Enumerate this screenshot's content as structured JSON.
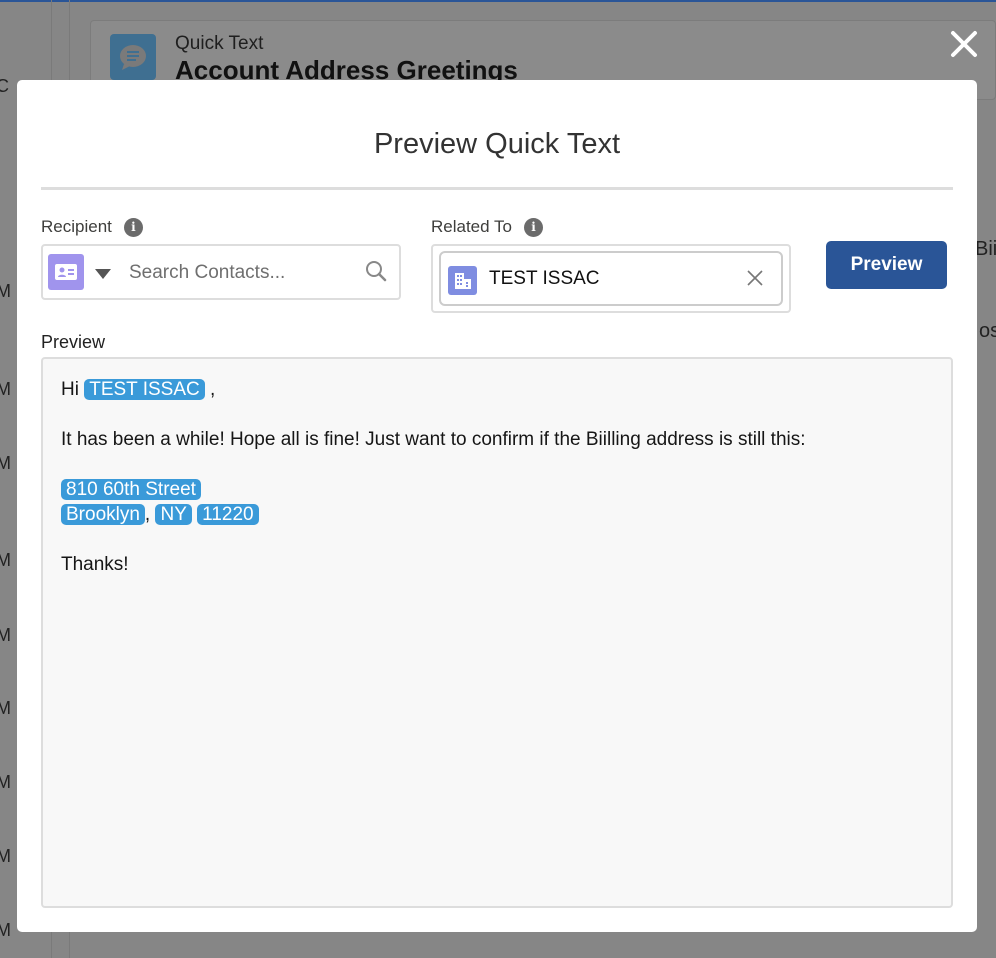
{
  "background": {
    "record_type": "Quick Text",
    "record_title": "Account Address Greetings",
    "left_fragments": [
      "M",
      "M",
      "M",
      "M",
      "M",
      "M",
      "M",
      "M",
      "M",
      "M"
    ],
    "right_fragments": [
      "Bii",
      "os"
    ]
  },
  "modal": {
    "title": "Preview Quick Text",
    "close_icon": "close-icon",
    "recipient": {
      "label": "Recipient",
      "placeholder": "Search Contacts...",
      "value": "",
      "icon": "contact-icon"
    },
    "related_to": {
      "label": "Related To",
      "value": "TEST ISSAC",
      "icon": "account-icon"
    },
    "preview_button": "Preview",
    "preview_label": "Preview",
    "preview": {
      "greeting": "Hi",
      "name_field": "TEST ISSAC",
      "greeting_end": " ,",
      "body": "It has been a while! Hope all is fine! Just want to confirm if the Biilling address is still this:",
      "street": "810 60th Street",
      "city": "Brooklyn",
      "comma": ", ",
      "state": "NY",
      "zip": "11220",
      "closing": "Thanks!"
    },
    "merge_field_color": "#3a9ad9",
    "button_color": "#2a5597"
  }
}
